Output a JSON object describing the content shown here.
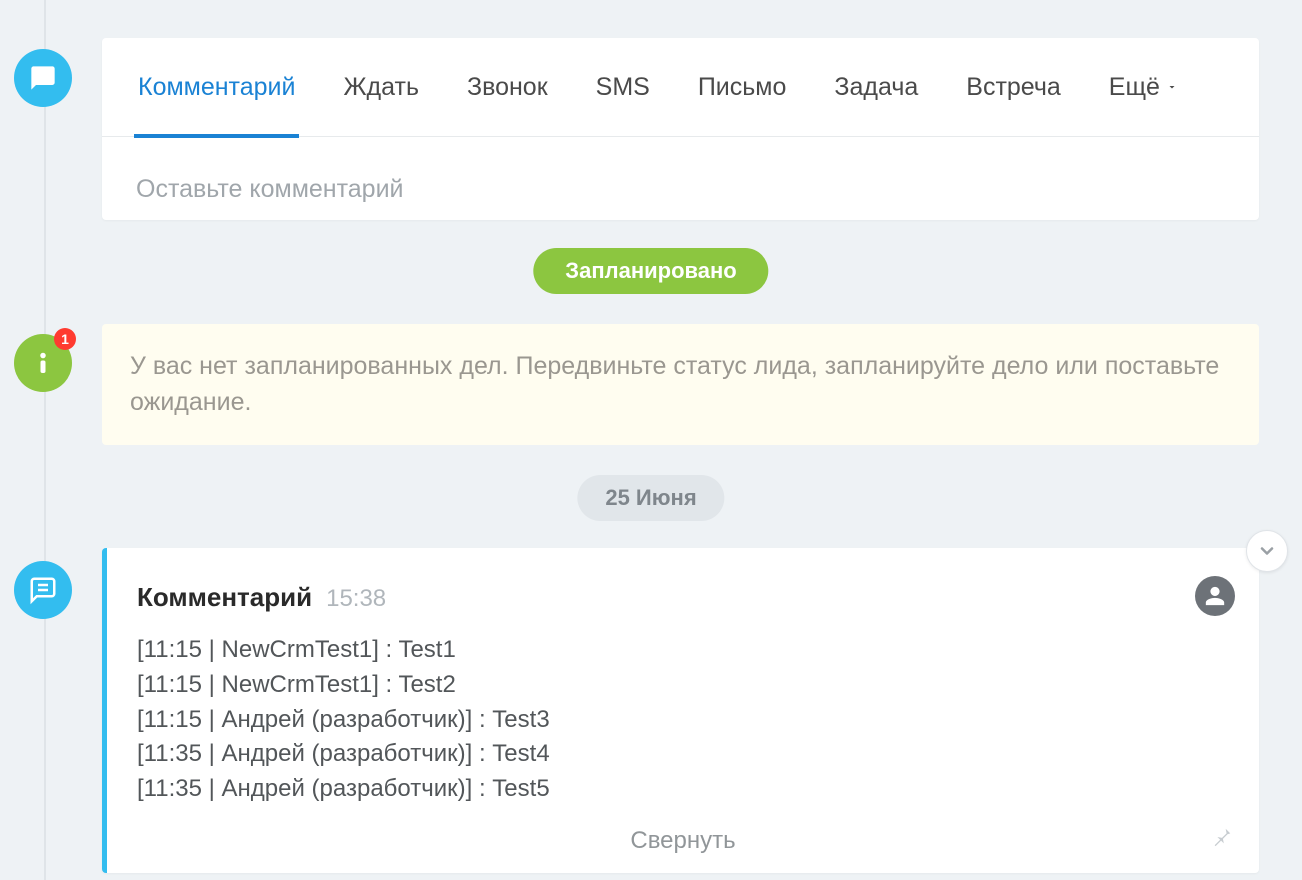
{
  "tabs": {
    "comment": "Комментарий",
    "wait": "Ждать",
    "call": "Звонок",
    "sms": "SMS",
    "mail": "Письмо",
    "task": "Задача",
    "meeting": "Встреча",
    "more": "Ещё"
  },
  "comment_input": {
    "placeholder": "Оставьте комментарий"
  },
  "status": {
    "planned": "Запланировано"
  },
  "info": {
    "badge": "1",
    "text": "У вас нет запланированных дел. Передвиньте статус лида, запланируйте дело или поставьте ожидание."
  },
  "date_separator": "25 Июня",
  "entry": {
    "title": "Комментарий",
    "time": "15:38",
    "lines": [
      "[11:15 | NewCrmTest1] : Test1",
      "[11:15 | NewCrmTest1] : Test2",
      "[11:15 | Андрей (разработчик)] : Test3",
      "[11:35 | Андрей (разработчик)] : Test4",
      "[11:35 | Андрей (разработчик)] : Test5"
    ],
    "collapse": "Свернуть"
  }
}
